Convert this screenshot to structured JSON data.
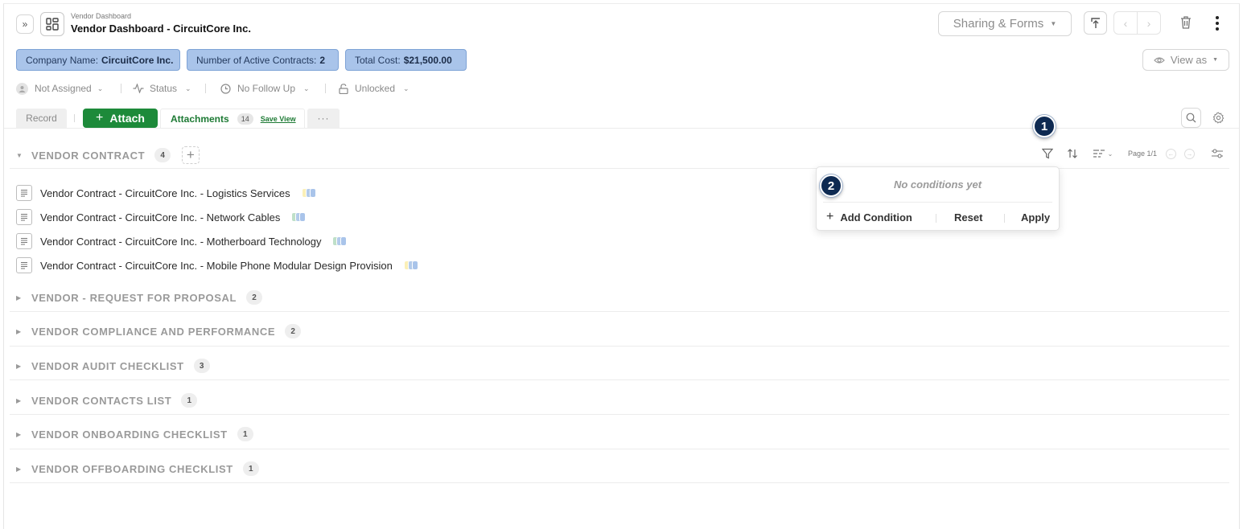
{
  "header": {
    "breadcrumb": "Vendor Dashboard",
    "title": "Vendor Dashboard - CircuitCore Inc.",
    "sharing_forms_label": "Sharing & Forms",
    "view_as_label": "View as"
  },
  "chips": [
    {
      "label": "Company Name:",
      "value": "CircuitCore Inc."
    },
    {
      "label": "Number of Active Contracts:",
      "value": "2"
    },
    {
      "label": "Total Cost:",
      "value": "$21,500.00"
    }
  ],
  "meta": {
    "assignee": "Not Assigned",
    "status": "Status",
    "follow_up": "No Follow Up",
    "lock": "Unlocked"
  },
  "tabs": {
    "record": "Record",
    "attach": "Attach",
    "attachments": "Attachments",
    "attachments_count": "14",
    "save_view": "Save View",
    "more": "···"
  },
  "toolbar": {
    "page": "Page 1/1"
  },
  "filter_popup": {
    "empty": "No conditions yet",
    "add_condition": "Add Condition",
    "reset": "Reset",
    "apply": "Apply"
  },
  "callouts": [
    "1",
    "2"
  ],
  "sections": [
    {
      "title": "VENDOR CONTRACT",
      "count": "4",
      "expanded": true,
      "items": [
        {
          "name": "Vendor Contract - CircuitCore Inc. - Logistics Services",
          "tags": [
            "#fbf0b8",
            "#b3cbea",
            "#a9c4ea"
          ]
        },
        {
          "name": "Vendor Contract - CircuitCore Inc. - Network Cables",
          "tags": [
            "#bfe0c9",
            "#b3cbea",
            "#a9c4ea"
          ]
        },
        {
          "name": "Vendor Contract - CircuitCore Inc. - Motherboard Technology",
          "tags": [
            "#bfe0c9",
            "#b3cbea",
            "#a9c4ea"
          ]
        },
        {
          "name": "Vendor Contract - CircuitCore Inc. - Mobile Phone Modular Design Provision",
          "tags": [
            "#fbf0b8",
            "#b3cbea",
            "#a9c4ea"
          ]
        }
      ]
    },
    {
      "title": "VENDOR - REQUEST FOR PROPOSAL",
      "count": "2",
      "expanded": false
    },
    {
      "title": "VENDOR COMPLIANCE AND PERFORMANCE",
      "count": "2",
      "expanded": false
    },
    {
      "title": "VENDOR AUDIT CHECKLIST",
      "count": "3",
      "expanded": false
    },
    {
      "title": "VENDOR CONTACTS LIST",
      "count": "1",
      "expanded": false
    },
    {
      "title": "VENDOR ONBOARDING CHECKLIST",
      "count": "1",
      "expanded": false
    },
    {
      "title": "VENDOR OFFBOARDING CHECKLIST",
      "count": "1",
      "expanded": false
    }
  ]
}
